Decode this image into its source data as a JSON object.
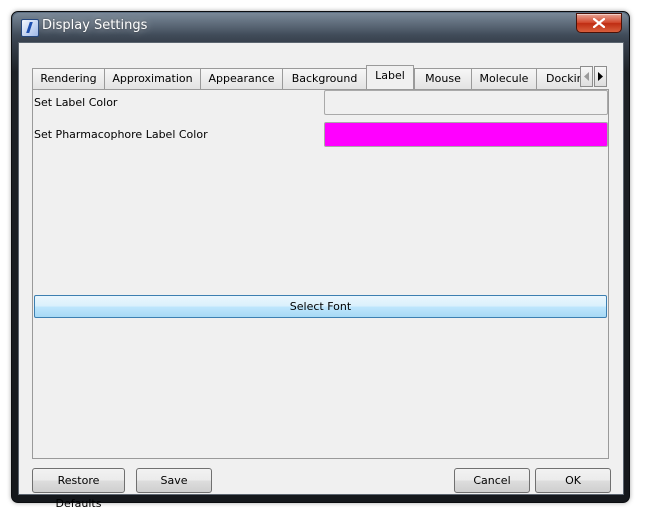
{
  "window": {
    "title": "Display Settings"
  },
  "tabs": [
    {
      "label": "Rendering"
    },
    {
      "label": "Approximation"
    },
    {
      "label": "Appearance"
    },
    {
      "label": "Background"
    },
    {
      "label": "Label"
    },
    {
      "label": "Mouse"
    },
    {
      "label": "Molecule"
    },
    {
      "label": "Docking"
    }
  ],
  "active_tab": "Label",
  "label_panel": {
    "label_color_text": "Set Label Color",
    "label_color_value": "#f0f0f0",
    "pharmacophore_color_text": "Set Pharmacophore Label Color",
    "pharmacophore_color_value": "#ff00ff",
    "select_font_label": "Select Font"
  },
  "buttons": {
    "restore_defaults": "Restore Defaults",
    "save": "Save",
    "cancel": "Cancel",
    "ok": "OK"
  }
}
